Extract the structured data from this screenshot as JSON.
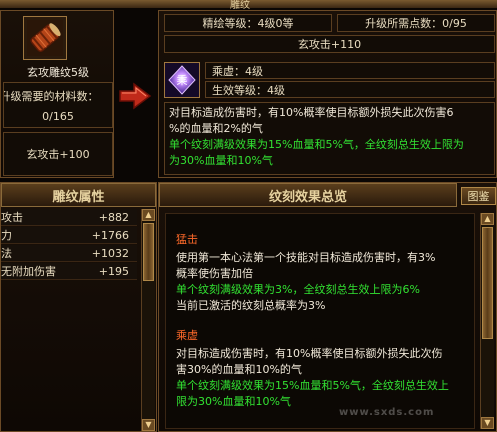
{
  "window": {
    "title": "雕纹"
  },
  "item": {
    "name": "玄攻雕纹5级",
    "materials_label": "升级需要的材料数：",
    "materials_value": "0/165",
    "stat": "玄攻击+100"
  },
  "upgrade": {
    "level_label": "精绘等级：4级0等",
    "points_label": "升级所需点数：0/95",
    "stat": "玄攻击+110",
    "skill_name": "乘虚：4级",
    "effect_level": "生效等级：4级",
    "desc_lines": [
      "对目标造成伤害时，有10%概率使目标额外损失此次伤害6",
      "%的血量和2%的气",
      "单个纹刻满级效果为15%血量和5%气，全纹刻总生效上限为",
      "为30%血量和10%气"
    ]
  },
  "attributes": {
    "title": "雕纹属性",
    "rows": [
      {
        "name": "攻击",
        "value": "+882"
      },
      {
        "name": "力",
        "value": "+1766"
      },
      {
        "name": "法",
        "value": "+1032"
      },
      {
        "name": "无附加伤害",
        "value": "+195"
      }
    ]
  },
  "overview": {
    "title": "纹刻效果总览",
    "tab": "图鉴",
    "sections": [
      {
        "title": "猛击",
        "desc": [
          "使用第一本心法第一个技能对目标造成伤害时，有3%",
          "概率使伤害加倍"
        ],
        "limit": "单个纹刻满级效果为3%，全纹刻总生效上限为6%",
        "current": "当前已激活的纹刻总概率为3%"
      },
      {
        "title": "乘虚",
        "desc": [
          "对目标造成伤害时，有10%概率使目标额外损失此次伤",
          "害30%的血量和10%的气"
        ],
        "limit": "单个纹刻满级效果为15%血量和5%气，全纹刻总生效上",
        "limit2": "限为30%血量和10%气"
      }
    ]
  },
  "watermark": "www.sxds.com",
  "colors": {
    "accent_green": "#32e232",
    "accent_red": "#ff6a2a",
    "gold_border": "#8a6a3a"
  }
}
